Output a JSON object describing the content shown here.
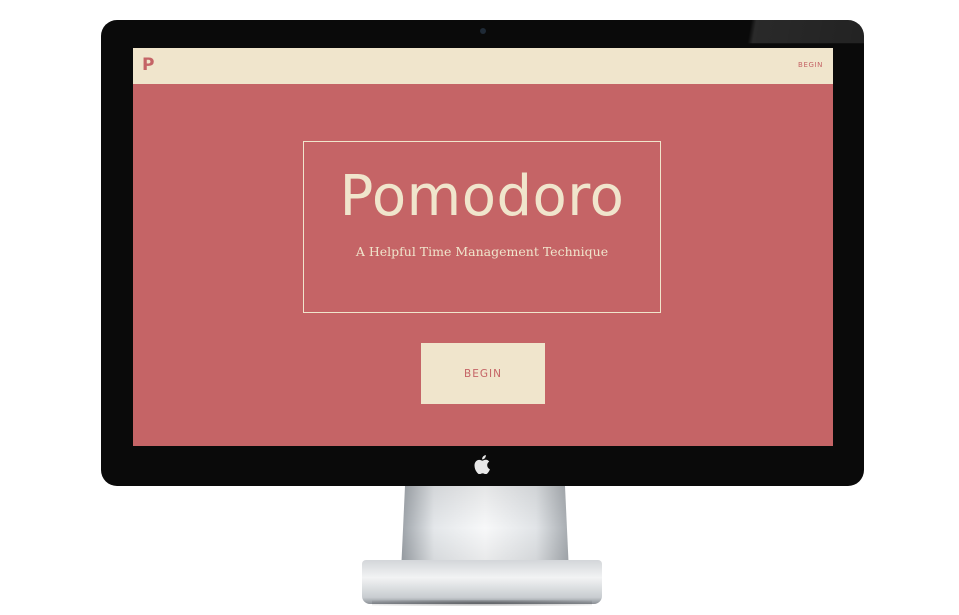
{
  "navbar": {
    "brand": "P",
    "begin_link": "BEGIN"
  },
  "hero": {
    "title": "Pomodoro",
    "subtitle": "A Helpful Time Management Technique"
  },
  "cta": {
    "begin_label": "BEGIN"
  },
  "colors": {
    "background": "#c56466",
    "cream": "#f0e5cc",
    "bezel": "#0a0a0a"
  },
  "icons": {
    "monitor_logo": "apple-icon"
  }
}
